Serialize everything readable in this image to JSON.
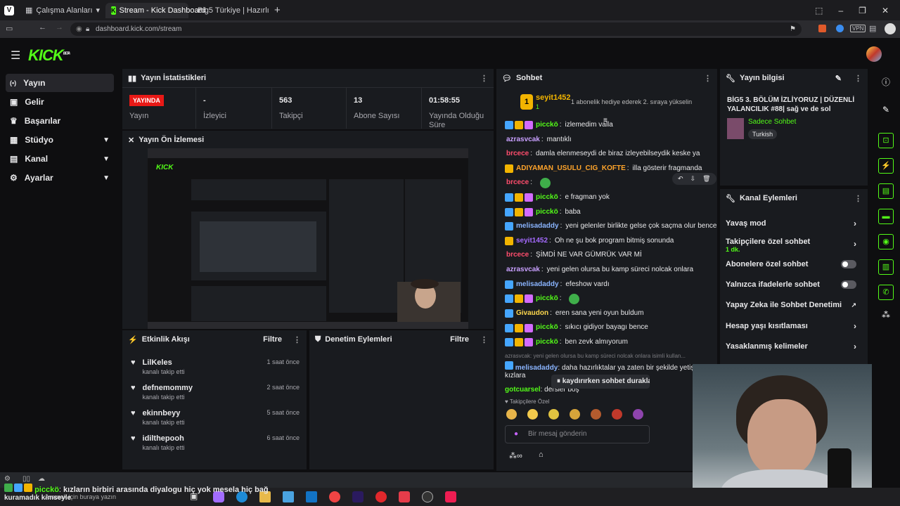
{
  "browser": {
    "tabs": [
      {
        "label": "Çalışma Alanları"
      },
      {
        "label": "Stream - Kick Dashboard"
      },
      {
        "label": "Big5 Türkiye | Hazırlık Sezon"
      }
    ],
    "url": "dashboard.kick.com/stream",
    "vpn": "VPN"
  },
  "kick": {
    "logo": "KICK",
    "beta": "BETA"
  },
  "sidebar": {
    "items": [
      {
        "label": "Yayın"
      },
      {
        "label": "Gelir"
      },
      {
        "label": "Başarılar"
      },
      {
        "label": "Stüdyo"
      },
      {
        "label": "Kanal"
      },
      {
        "label": "Ayarlar"
      }
    ]
  },
  "stats": {
    "title": "Yayın İstatistikleri",
    "live_badge": "YAYINDA",
    "status_label": "Yayın",
    "viewers_value": "-",
    "viewers_label": "İzleyici",
    "followers_value": "563",
    "followers_label": "Takipçi",
    "subs_value": "13",
    "subs_label": "Abone Sayısı",
    "duration_value": "01:58:55",
    "duration_label": "Yayında Olduğu Süre"
  },
  "preview": {
    "title": "Yayın Ön İzlemesi"
  },
  "activity": {
    "title": "Etkinlik Akışı",
    "filter": "Filtre",
    "events": [
      {
        "name": "LilKeles",
        "sub": "kanalı takip etti",
        "time": "1 saat önce"
      },
      {
        "name": "defnemommy",
        "sub": "kanalı takip etti",
        "time": "2 saat önce"
      },
      {
        "name": "ekinnbeyy",
        "sub": "kanalı takip etti",
        "time": "5 saat önce"
      },
      {
        "name": "idilthepooh",
        "sub": "kanalı takip etti",
        "time": "6 saat önce"
      }
    ]
  },
  "moderation": {
    "title": "Denetim Eylemleri",
    "filter": "Filtre"
  },
  "chat": {
    "title": "Sohbet",
    "pinned_user": "seyit1452",
    "pinned_count": "1",
    "pinned_text": "1 abonelik hediye ederek 2. sıraya yükselin",
    "messages": [
      {
        "user": "picckö",
        "text": "izlemedim valla",
        "color": "#53fc18"
      },
      {
        "user": "azrasvcak",
        "text": "mantıklı",
        "color": "#c9a0ff"
      },
      {
        "user": "brcece",
        "text": "damla elenmeseydi de biraz izleyebilseydik keske ya",
        "color": "#ff4d6d"
      },
      {
        "user": "ADIYAMAN_USULU_CIG_KOFTE",
        "text": "illa gösterir fragmanda",
        "color": "#ffa42b"
      },
      {
        "user": "brcece",
        "text": "",
        "color": "#ff4d6d"
      },
      {
        "user": "picckö",
        "text": "e fragman yok",
        "color": "#53fc18"
      },
      {
        "user": "picckö",
        "text": "baba",
        "color": "#53fc18"
      },
      {
        "user": "melisadaddy",
        "text": "yeni gelenler birlikte gelse çok saçma olur bence",
        "color": "#8ab4ff"
      },
      {
        "user": "seyit1452",
        "text": "Oh ne şu bok program bitmiş sonunda",
        "color": "#a56bff"
      },
      {
        "user": "brcece",
        "text": "ŞİMDİ NE VAR GÜMRÜK VAR Mİ",
        "color": "#ff4d6d"
      },
      {
        "user": "azrasvcak",
        "text": "yeni gelen olursa bu kamp süreci nolcak onlara",
        "color": "#c9a0ff"
      },
      {
        "user": "melisadaddy",
        "text": "efeshow vardı",
        "color": "#8ab4ff"
      },
      {
        "user": "picckö",
        "text": "",
        "color": "#53fc18"
      },
      {
        "user": "Givaudon",
        "text": "eren sana yeni oyun buldum",
        "color": "#ffd84d"
      },
      {
        "user": "picckö",
        "text": "sıkıcı gidiyor bayagı bence",
        "color": "#53fc18"
      },
      {
        "user": "picckö",
        "text": "ben zevk almıyorum",
        "color": "#53fc18"
      }
    ],
    "reply_preview": "azrasvcak: yeni gelen olursa bu kamp süreci nolcak onlara isimli kullan...",
    "reply_user": "melisadaddy",
    "reply_text": "daha hazırlıktalar ya zaten bir şekilde yetişirler diğer",
    "reply_cont": "kızlara",
    "last_user": "gotcuarsel",
    "last_text": "dersler boş",
    "paused": "kaydırırken sohbet duraklatıldı",
    "follower_only": "Takipçilere Özel",
    "input_placeholder": "Bir mesaj gönderin"
  },
  "stream_info": {
    "title": "Yayın bilgisi",
    "stream_title": "BİG5 3. BÖLÜM İZLİYORUZ | DÜZENLİ YALANCILIK #88| sağ ve de sol",
    "category": "Sadece Sohbet",
    "language": "Turkish"
  },
  "channel_actions": {
    "title": "Kanal Eylemleri",
    "items": [
      {
        "label": "Yavaş mod"
      },
      {
        "label": "Takipçilere özel sohbet",
        "sub": "1 dk."
      },
      {
        "label": "Abonelere özel sohbet"
      },
      {
        "label": "Yalnızca ifadelerle sohbet"
      },
      {
        "label": "Yapay Zeka ile Sohbet Denetimi"
      },
      {
        "label": "Hesap yaşı kısıtlaması"
      },
      {
        "label": "Yasaklanmış kelimeler"
      }
    ]
  },
  "overlay": {
    "chat_user": "picckö",
    "chat_text": "kızların birbiri arasında diyalogu hiç yok mesela hiç bağ",
    "chat_cont": "kuramadık kimseyle",
    "search": "Aramak için buraya yazın"
  },
  "colors": {
    "accent": "#53fc18",
    "live": "#e91916",
    "panel": "#191b1f",
    "bg": "#0e0e10"
  }
}
